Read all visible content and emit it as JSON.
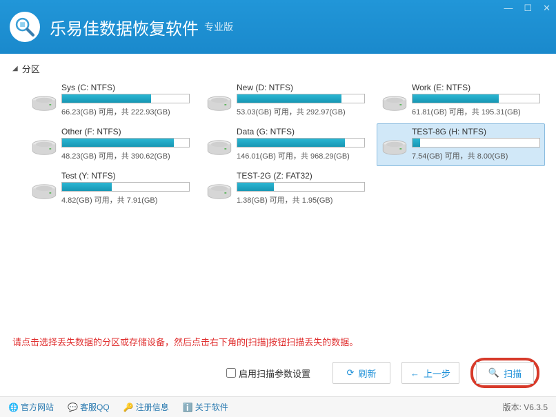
{
  "app": {
    "title": "乐易佳数据恢复软件",
    "edition": "专业版"
  },
  "section": {
    "label": "分区"
  },
  "partitions": [
    {
      "label": "Sys (C: NTFS)",
      "free": "66.23(GB)",
      "total": "222.93(GB)",
      "fill": 70,
      "selected": false
    },
    {
      "label": "New (D: NTFS)",
      "free": "53.03(GB)",
      "total": "292.97(GB)",
      "fill": 82,
      "selected": false
    },
    {
      "label": "Work (E: NTFS)",
      "free": "61.81(GB)",
      "total": "195.31(GB)",
      "fill": 68,
      "selected": false
    },
    {
      "label": "Other (F: NTFS)",
      "free": "48.23(GB)",
      "total": "390.62(GB)",
      "fill": 88,
      "selected": false
    },
    {
      "label": "Data (G: NTFS)",
      "free": "146.01(GB)",
      "total": "968.29(GB)",
      "fill": 85,
      "selected": false
    },
    {
      "label": "TEST-8G (H: NTFS)",
      "free": "7.54(GB)",
      "total": "8.00(GB)",
      "fill": 6,
      "selected": true
    },
    {
      "label": "Test (Y: NTFS)",
      "free": "4.82(GB)",
      "total": "7.91(GB)",
      "fill": 39,
      "selected": false
    },
    {
      "label": "TEST-2G (Z: FAT32)",
      "free": "1.38(GB)",
      "total": "1.95(GB)",
      "fill": 29,
      "selected": false
    }
  ],
  "text": {
    "avail": " 可用，共 ",
    "hint": "请点击选择丢失数据的分区或存储设备，然后点击右下角的[扫描]按钮扫描丢失的数据。",
    "enableParams": "启用扫描参数设置",
    "refresh": "刷新",
    "prev": "上一步",
    "scan": "扫描"
  },
  "footer": {
    "site": "官方网站",
    "qq": "客服QQ",
    "reg": "注册信息",
    "about": "关于软件",
    "version": "版本: V6.3.5"
  }
}
